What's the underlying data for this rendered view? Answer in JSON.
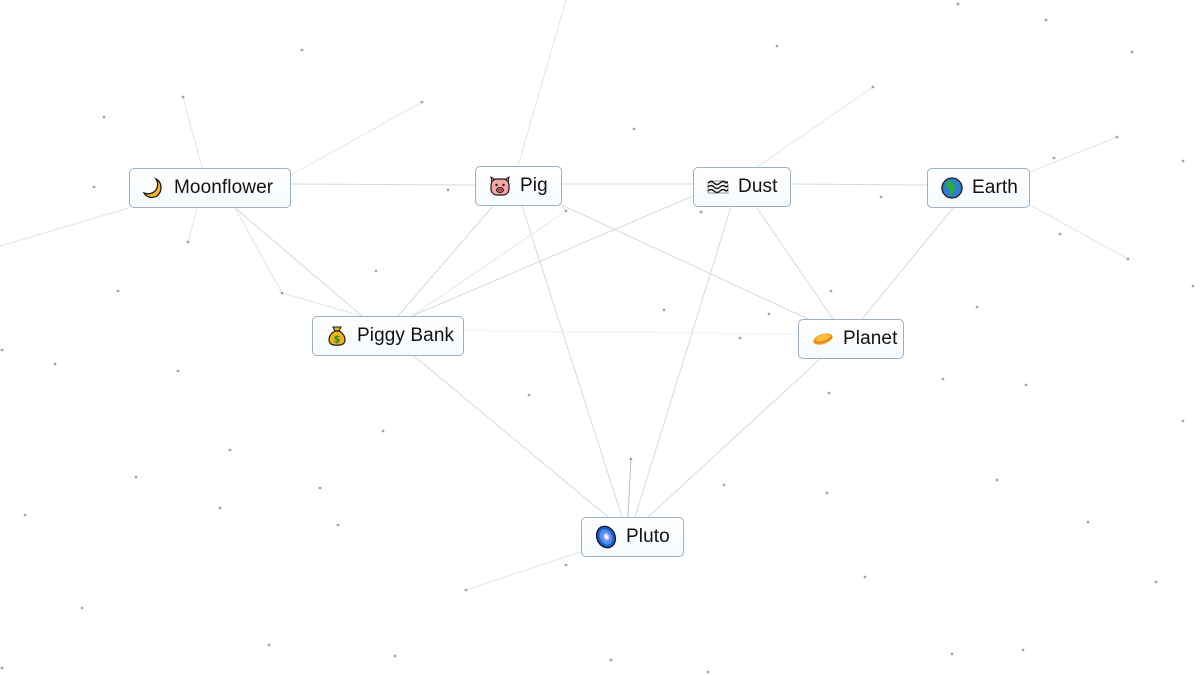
{
  "app": {
    "name": "Infinite Craft canvas",
    "background": "#ffffff",
    "line_color": "#c9cdd2",
    "dot_color": "#8a8a8a",
    "node_border": "#9fb0c2"
  },
  "nodes": [
    {
      "id": "moonflower",
      "label": "Moonflower",
      "icon": "crescent-moon-icon",
      "emoji": "🌙"
    },
    {
      "id": "pig",
      "label": "Pig",
      "icon": "pig-face-icon",
      "emoji": "🐷"
    },
    {
      "id": "dust",
      "label": "Dust",
      "icon": "dash-wave-icon",
      "emoji": "🌫"
    },
    {
      "id": "earth",
      "label": "Earth",
      "icon": "globe-icon",
      "emoji": "🌍"
    },
    {
      "id": "piggy_bank",
      "label": "Piggy Bank",
      "icon": "money-bag-icon",
      "emoji": "💰"
    },
    {
      "id": "planet",
      "label": "Planet",
      "icon": "ringed-planet-icon",
      "emoji": "🪐"
    },
    {
      "id": "pluto",
      "label": "Pluto",
      "icon": "galaxy-swirl-icon",
      "emoji": "🌌"
    }
  ],
  "connections": [
    [
      "moonflower",
      "pig"
    ],
    [
      "pig",
      "dust"
    ],
    [
      "dust",
      "earth"
    ],
    [
      "moonflower",
      "piggy_bank"
    ],
    [
      "pig",
      "piggy_bank"
    ],
    [
      "dust",
      "piggy_bank"
    ],
    [
      "pig",
      "planet"
    ],
    [
      "dust",
      "planet"
    ],
    [
      "earth",
      "planet"
    ],
    [
      "piggy_bank",
      "pluto"
    ],
    [
      "pig",
      "pluto"
    ],
    [
      "dust",
      "pluto"
    ],
    [
      "planet",
      "pluto"
    ]
  ]
}
